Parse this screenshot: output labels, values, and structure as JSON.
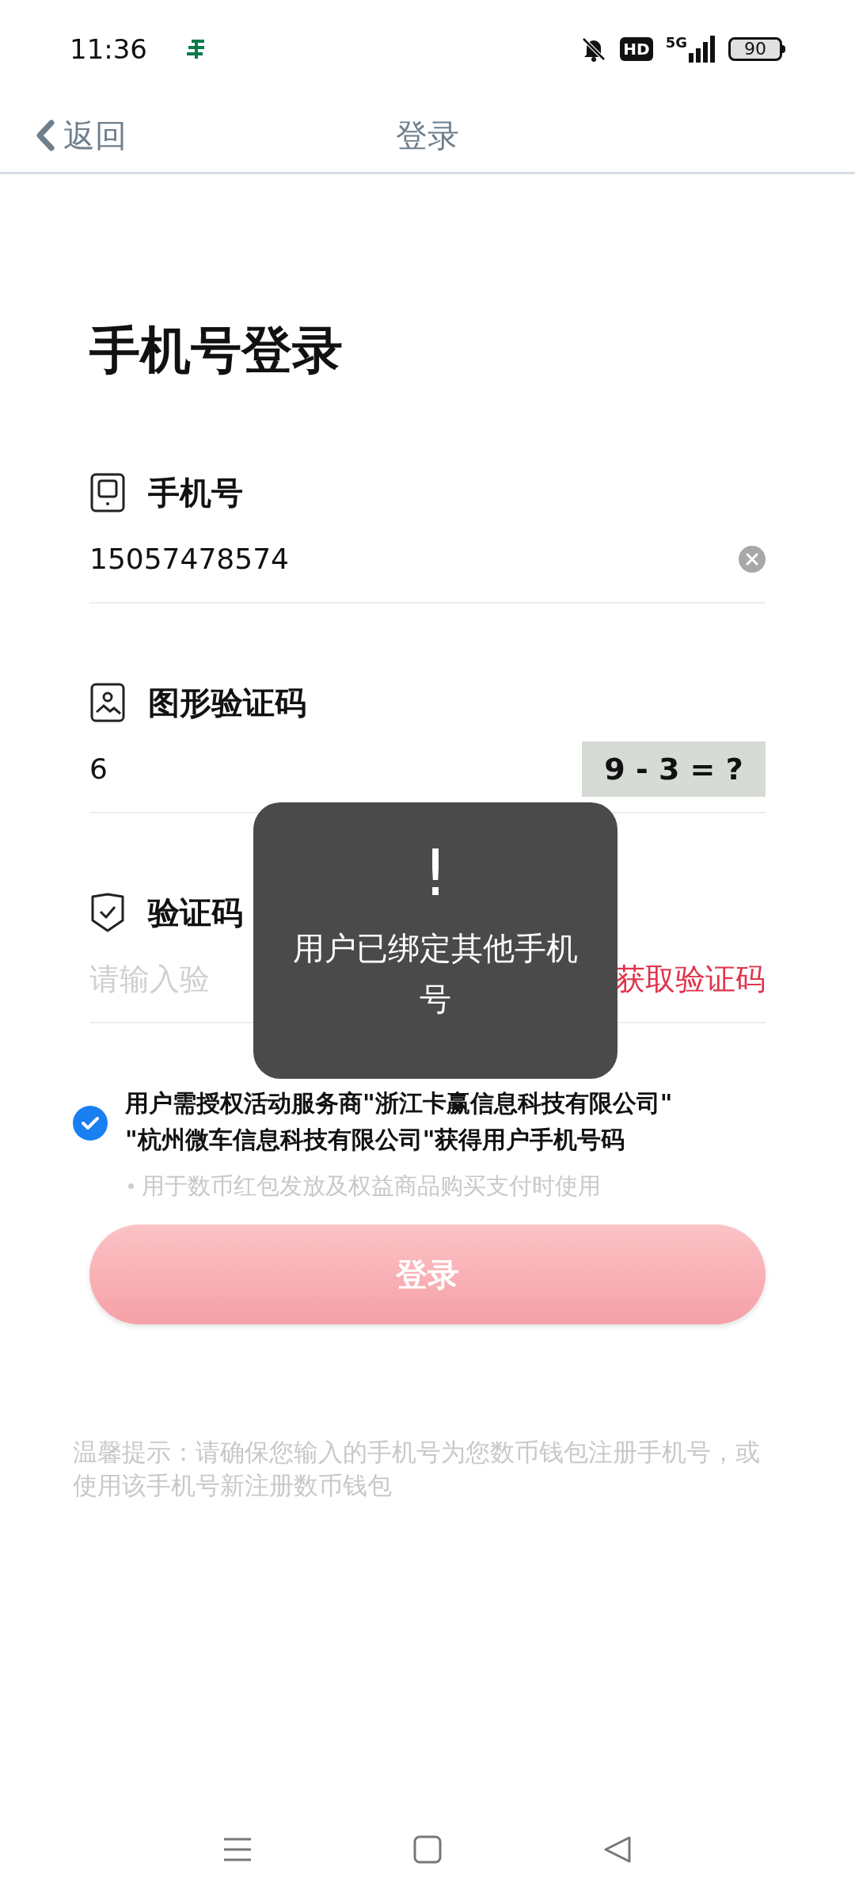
{
  "status_bar": {
    "time": "11:36",
    "network": "5G",
    "hd": "HD",
    "battery": "90"
  },
  "nav": {
    "back": "返回",
    "title": "登录"
  },
  "heading": "手机号登录",
  "fields": [
    {
      "kind": "phone",
      "label": "手机号",
      "value": "15057478574"
    },
    {
      "kind": "captcha",
      "label": "图形验证码",
      "value": "6",
      "captcha": "9 - 3 = ?"
    },
    {
      "kind": "code",
      "label": "验证码",
      "placeholder": "请输入验",
      "action": "获取验证码"
    }
  ],
  "agreement": {
    "checked": true,
    "lines": [
      "用户需授权活动服务商\"浙江卡赢信息科技有限公司\"",
      "\"杭州微车信息科技有限公司\"获得用户手机号码"
    ],
    "note": "用于数币红包发放及权益商品购买支付时使用"
  },
  "login_button": {
    "label": "登录",
    "disabled": true
  },
  "tip": "温馨提示：请确保您输入的手机号为您数币钱包注册手机号，或使用该手机号新注册数币钱包",
  "toast": {
    "icon": "!",
    "message": "用户已绑定其他手机号"
  }
}
